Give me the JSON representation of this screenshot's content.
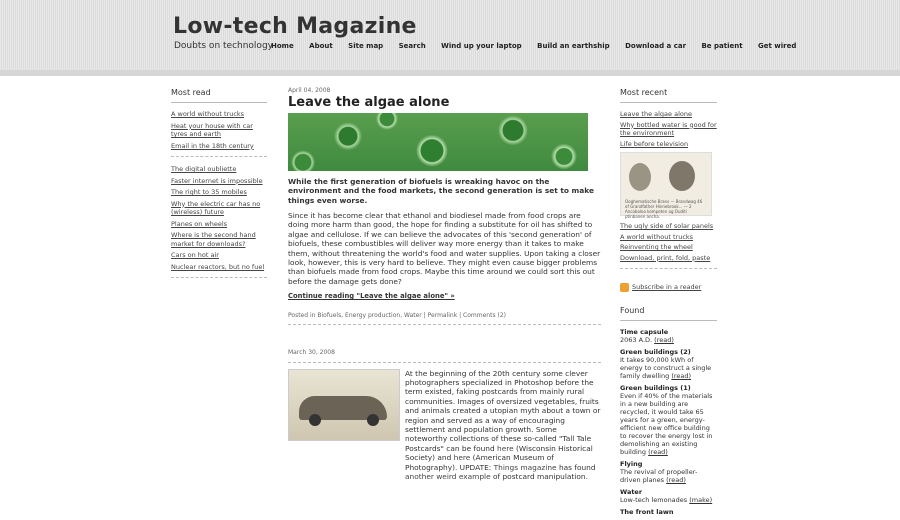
{
  "header": {
    "title": "Low-tech Magazine",
    "tagline": "Doubts on technology",
    "nav": [
      "Home",
      "About",
      "Site map",
      "Search",
      "Wind up your laptop",
      "Build an earthship",
      "Download a car",
      "Be patient",
      "Get wired"
    ]
  },
  "left": {
    "heading": "Most read",
    "group1": [
      "A world without trucks",
      "Heat your house with car tyres and earth",
      "Email in the 18th century"
    ],
    "group2": [
      "The digital oubliette",
      "Faster internet is impossible",
      "The right to 35 mobiles",
      "Why the electric car has no (wireless) future",
      "Planes on wheels",
      "Where is the second hand market for downloads?",
      "Cars on hot air",
      "Nuclear reactors, but no fuel"
    ]
  },
  "post1": {
    "date": "April 04, 2008",
    "title": "Leave the algae alone",
    "lead": "While the first generation of biofuels is wreaking havoc on the environment and the food markets, the second generation is set to make things even worse.",
    "body": "Since it has become clear that ethanol and biodiesel made from food crops are doing more harm than good, the hope for finding a substitute for oil has shifted to algae and cellulose. If we can believe the advocates of this 'second generation' of biofuels, these combustibles will deliver way more energy than it takes to make them, without threatening the world's food and water supplies. Upon taking a closer look, however, this is very hard to believe. They might even cause bigger problems than biofuels made from food crops. Maybe this time around we could sort this out before the damage gets done?",
    "continue": "Continue reading \"Leave the algae alone\" »",
    "posted_in": "Posted in",
    "cat1": "Biofuels",
    "cat2": "Energy production",
    "cat3": "Water",
    "permalink": "Permalink",
    "comments": "Comments (2)"
  },
  "post2": {
    "date": "March 30, 2008",
    "text1": "At the beginning of the 20th century some clever photographers specialized in Photoshop before the term existed, faking postcards from mainly rural communities. Images of oversized vegetables, fruits and animals created a utopian myth about a town or region and served as a way of encouraging settlement and population growth. Some noteworthy collections of these so-called \"Tall Tale Postcards\" can be found",
    "here1": "here",
    "text2": "(Wisconsin Historical Society) and",
    "here2": "here",
    "text3": "(American Museum of Photography). UPDATE:",
    "things": "Things magazine",
    "text4": "has found",
    "weird": "another weird example",
    "text5": "of postcard manipulation."
  },
  "right": {
    "heading": "Most recent",
    "recent1": [
      "Leave the algae alone",
      "Why bottled water is good for the environment",
      "Life before television"
    ],
    "img_caption": "Ooghematische Brans — Brandwag 46 of Grandfather Hinnebrook... — 2 Ancoboloo kompeten ag Ouditi ptinbanen ancha.",
    "recent2": [
      "The ugly side of solar panels",
      "A world without trucks",
      "Reinventing the wheel",
      "Download, print, fold, paste"
    ],
    "subscribe": "Subscribe in a reader",
    "found_heading": "Found",
    "found": [
      {
        "title": "Time capsule",
        "desc": "2063 A.D.",
        "link": "(read)"
      },
      {
        "title": "Green buildings (2)",
        "desc": "It takes 90,000 kWh of energy to construct a single family dwelling",
        "link": "(read)"
      },
      {
        "title": "Green buildings (1)",
        "desc": "Even if 40% of the materials in a new building are recycled, it would take 65 years for a green, energy-efficient new office building to recover the energy lost in demolishing an existing building",
        "link": "(read)"
      },
      {
        "title": "Flying",
        "desc": "The revival of propeller-driven planes",
        "link": "(read)"
      },
      {
        "title": "Water",
        "desc": "Low-tech lemonades",
        "link": "(make)"
      },
      {
        "title": "The front lawn",
        "desc": "",
        "link": ""
      }
    ]
  }
}
